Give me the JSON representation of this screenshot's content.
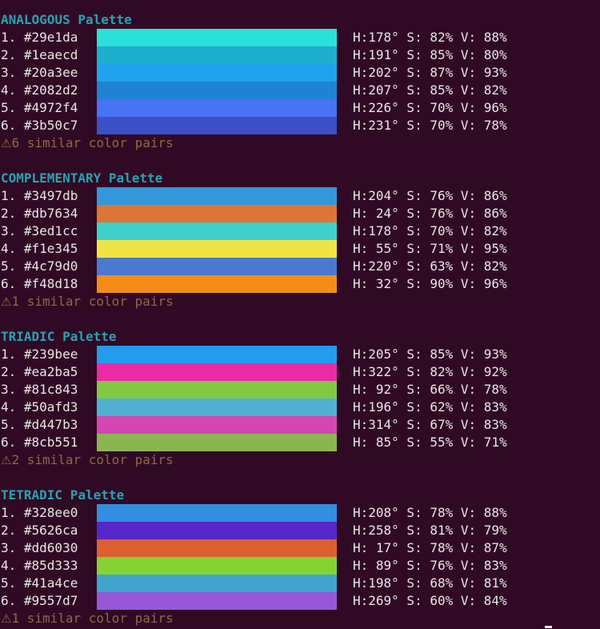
{
  "palettes": [
    {
      "title": "ANALOGOUS Palette",
      "colors": [
        {
          "label": "1. #29e1da",
          "hex": "#29e1da",
          "hsv": "H:178° S: 82% V: 88%"
        },
        {
          "label": "2. #1eaecd",
          "hex": "#1eaecd",
          "hsv": "H:191° S: 85% V: 80%"
        },
        {
          "label": "3. #20a3ee",
          "hex": "#20a3ee",
          "hsv": "H:202° S: 87% V: 93%"
        },
        {
          "label": "4. #2082d2",
          "hex": "#2082d2",
          "hsv": "H:207° S: 85% V: 82%"
        },
        {
          "label": "5. #4972f4",
          "hex": "#4972f4",
          "hsv": "H:226° S: 70% V: 96%"
        },
        {
          "label": "6. #3b50c7",
          "hex": "#3b50c7",
          "hsv": "H:231° S: 70% V: 78%"
        }
      ],
      "warning_icon": "⚠",
      "warning_text": "6 similar color pairs"
    },
    {
      "title": "COMPLEMENTARY Palette",
      "colors": [
        {
          "label": "1. #3497db",
          "hex": "#3497db",
          "hsv": "H:204° S: 76% V: 86%"
        },
        {
          "label": "2. #db7634",
          "hex": "#db7634",
          "hsv": "H: 24° S: 76% V: 86%"
        },
        {
          "label": "3. #3ed1cc",
          "hex": "#3ed1cc",
          "hsv": "H:178° S: 70% V: 82%"
        },
        {
          "label": "4. #f1e345",
          "hex": "#f1e345",
          "hsv": "H: 55° S: 71% V: 95%"
        },
        {
          "label": "5. #4c79d0",
          "hex": "#4c79d0",
          "hsv": "H:220° S: 63% V: 82%"
        },
        {
          "label": "6. #f48d18",
          "hex": "#f48d18",
          "hsv": "H: 32° S: 90% V: 96%"
        }
      ],
      "warning_icon": "⚠",
      "warning_text": "1 similar color pairs"
    },
    {
      "title": "TRIADIC Palette",
      "colors": [
        {
          "label": "1. #239bee",
          "hex": "#239bee",
          "hsv": "H:205° S: 85% V: 93%"
        },
        {
          "label": "2. #ea2ba5",
          "hex": "#ea2ba5",
          "hsv": "H:322° S: 82% V: 92%"
        },
        {
          "label": "3. #81c843",
          "hex": "#81c843",
          "hsv": "H: 92° S: 66% V: 78%"
        },
        {
          "label": "4. #50afd3",
          "hex": "#50afd3",
          "hsv": "H:196° S: 62% V: 83%"
        },
        {
          "label": "5. #d447b3",
          "hex": "#d447b3",
          "hsv": "H:314° S: 67% V: 83%"
        },
        {
          "label": "6. #8cb551",
          "hex": "#8cb551",
          "hsv": "H: 85° S: 55% V: 71%"
        }
      ],
      "warning_icon": "⚠",
      "warning_text": "2 similar color pairs"
    },
    {
      "title": "TETRADIC Palette",
      "colors": [
        {
          "label": "1. #328ee0",
          "hex": "#328ee0",
          "hsv": "H:208° S: 78% V: 88%"
        },
        {
          "label": "2. #5626ca",
          "hex": "#5626ca",
          "hsv": "H:258° S: 81% V: 79%"
        },
        {
          "label": "3. #dd6030",
          "hex": "#dd6030",
          "hsv": "H: 17° S: 78% V: 87%"
        },
        {
          "label": "4. #85d333",
          "hex": "#85d333",
          "hsv": "H: 89° S: 76% V: 83%"
        },
        {
          "label": "5. #41a4ce",
          "hex": "#41a4ce",
          "hsv": "H:198° S: 68% V: 81%"
        },
        {
          "label": "6. #9557d7",
          "hex": "#9557d7",
          "hsv": "H:269° S: 60% V: 84%"
        }
      ],
      "warning_icon": "⚠",
      "warning_text": "1 similar color pairs"
    }
  ],
  "theme": {
    "background": "#300a24",
    "title_color": "#2aa1b3",
    "text_color": "#e8e6e3",
    "warning_color": "#8b6a45"
  }
}
